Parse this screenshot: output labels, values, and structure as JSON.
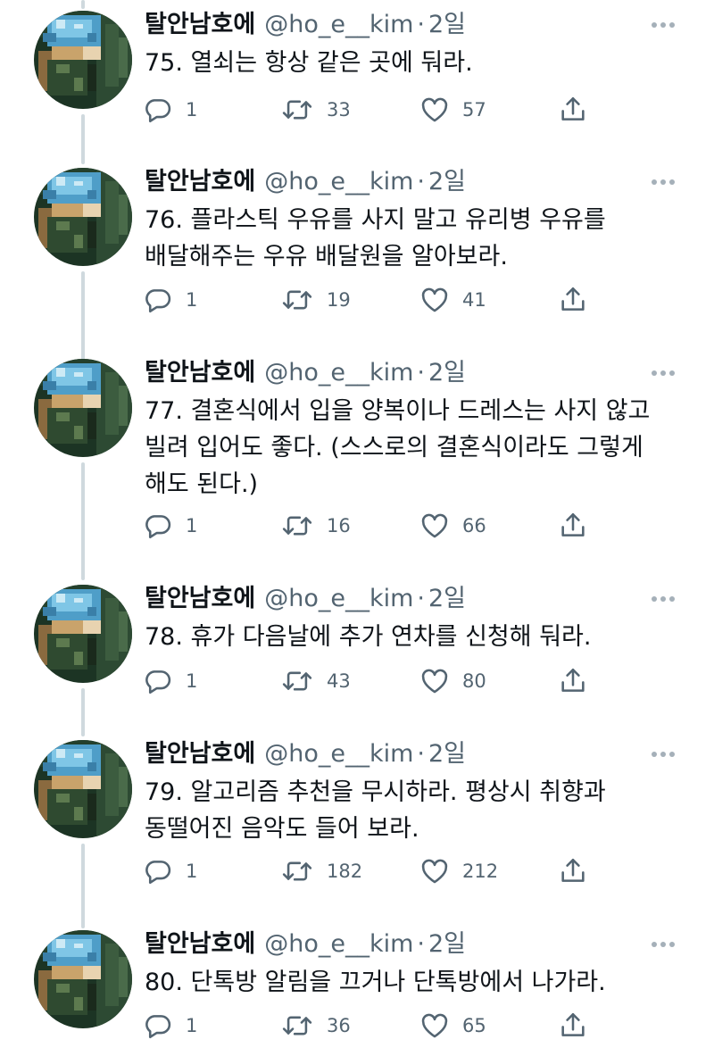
{
  "colors": {
    "text": "#0f1419",
    "secondary": "#536471",
    "thread_line": "#cfd9de",
    "background": "#ffffff"
  },
  "icons": {
    "reply": "reply-icon",
    "retweet": "retweet-icon",
    "like": "like-icon",
    "share": "share-icon",
    "more": "more-icon"
  },
  "tweets": [
    {
      "name": "탈안남호에",
      "handle": "@ho_e__kim",
      "dot": "·",
      "time": "2일",
      "text": "75. 열쇠는 항상 같은 곳에 둬라.",
      "replies": "1",
      "retweets": "33",
      "likes": "57"
    },
    {
      "name": "탈안남호에",
      "handle": "@ho_e__kim",
      "dot": "·",
      "time": "2일",
      "text": "76. 플라스틱 우유를 사지 말고 유리병 우유를 배달해주는 우유 배달원을 알아보라.",
      "replies": "1",
      "retweets": "19",
      "likes": "41"
    },
    {
      "name": "탈안남호에",
      "handle": "@ho_e__kim",
      "dot": "·",
      "time": "2일",
      "text": "77. 결혼식에서 입을 양복이나 드레스는 사지 않고 빌려 입어도 좋다. (스스로의 결혼식이라도 그렇게 해도 된다.)",
      "replies": "1",
      "retweets": "16",
      "likes": "66"
    },
    {
      "name": "탈안남호에",
      "handle": "@ho_e__kim",
      "dot": "·",
      "time": "2일",
      "text": "78. 휴가 다음날에 추가 연차를 신청해 둬라.",
      "replies": "1",
      "retweets": "43",
      "likes": "80"
    },
    {
      "name": "탈안남호에",
      "handle": "@ho_e__kim",
      "dot": "·",
      "time": "2일",
      "text": "79. 알고리즘 추천을 무시하라. 평상시 취향과 동떨어진 음악도 들어 보라.",
      "replies": "1",
      "retweets": "182",
      "likes": "212"
    },
    {
      "name": "탈안남호에",
      "handle": "@ho_e__kim",
      "dot": "·",
      "time": "2일",
      "text": "80. 단톡방 알림을 끄거나 단톡방에서 나가라.",
      "replies": "1",
      "retweets": "36",
      "likes": "65"
    }
  ]
}
